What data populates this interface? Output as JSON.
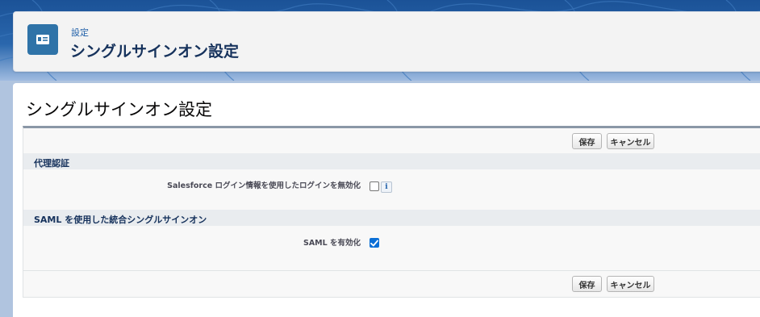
{
  "header": {
    "breadcrumb": "設定",
    "title": "シングルサインオン設定",
    "icon": "id-card-icon"
  },
  "page": {
    "title": "シングルサインオン設定"
  },
  "buttons": {
    "save": "保存",
    "cancel": "キャンセル"
  },
  "sections": [
    {
      "heading": "代理認証",
      "fields": [
        {
          "label": "Salesforce ログイン情報を使用したログインを無効化",
          "checked": false,
          "has_info": true,
          "info_label": "i"
        }
      ]
    },
    {
      "heading": "SAML を使用した統合シングルサインオン",
      "fields": [
        {
          "label": "SAML を有効化",
          "checked": true,
          "has_info": false
        }
      ]
    }
  ],
  "colors": {
    "brand_blue": "#2f73a8",
    "checkbox_checked": "#0b6fd6",
    "title_text": "#16325c"
  }
}
